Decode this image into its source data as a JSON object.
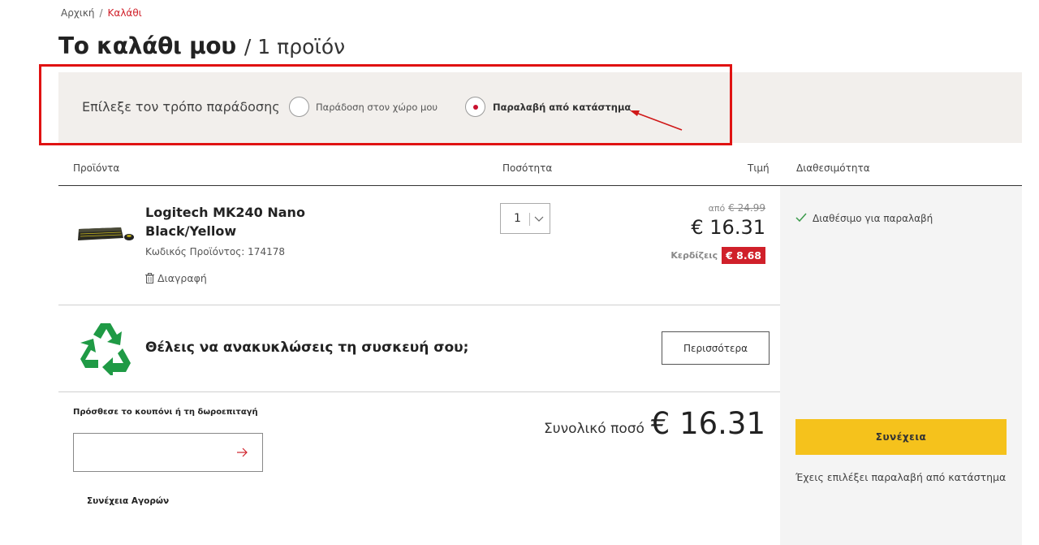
{
  "breadcrumb": {
    "home": "Αρχική",
    "separator": "/",
    "current": "Καλάθι"
  },
  "page": {
    "title": "Το καλάθι μου",
    "subtitle": "/ 1 προϊόν"
  },
  "delivery": {
    "label": "Επίλεξε τον τρόπο παράδοσης",
    "options": [
      {
        "label": "Παράδοση στον χώρο μου",
        "selected": false
      },
      {
        "label": "Παραλαβή από κατάστημα",
        "selected": true
      }
    ]
  },
  "table": {
    "headers": {
      "products": "Προϊόντα",
      "quantity": "Ποσότητα",
      "price": "Τιμή",
      "availability": "Διαθεσιμότητα"
    }
  },
  "cart_item": {
    "name": "Logitech MK240 Nano Black/Yellow",
    "code_label": "Κωδικός Προϊόντος:",
    "code": "174178",
    "delete_label": "Διαγραφή",
    "quantity": "1",
    "from_label": "από",
    "old_price": "€ 24.99",
    "price": "€ 16.31",
    "save_label": "Κερδίζεις",
    "save_amount": "€ 8.68",
    "availability": "Διαθέσιμο για παραλαβή"
  },
  "recycle": {
    "text": "Θέλεις να ανακυκλώσεις τη συσκευή σου;",
    "button_label": "Περισσότερα"
  },
  "coupon": {
    "label": "Πρόσθεσε το κουπόνι ή τη δωροεπιταγή",
    "placeholder": ""
  },
  "links": {
    "continue_shopping": "Συνέχεια Αγορών"
  },
  "summary": {
    "total_label": "Συνολικό ποσό",
    "total_value": "€ 16.31",
    "checkout_label": "Συνέχεια",
    "pickup_note": "Έχεις επιλέξει παραλαβή από κατάστημα"
  },
  "icons": {
    "delete": "trash-icon",
    "chevron": "chevron-down-icon",
    "check": "checkmark-icon",
    "recycle": "recycle-icon",
    "arrow": "arrow-right-icon"
  },
  "colors": {
    "accent_red": "#d0202a",
    "checkout_yellow": "#f5c21c",
    "recycle_green": "#1f9a45",
    "delivery_bg": "#f2efec",
    "side_panel_bg": "#f4f4f4"
  }
}
